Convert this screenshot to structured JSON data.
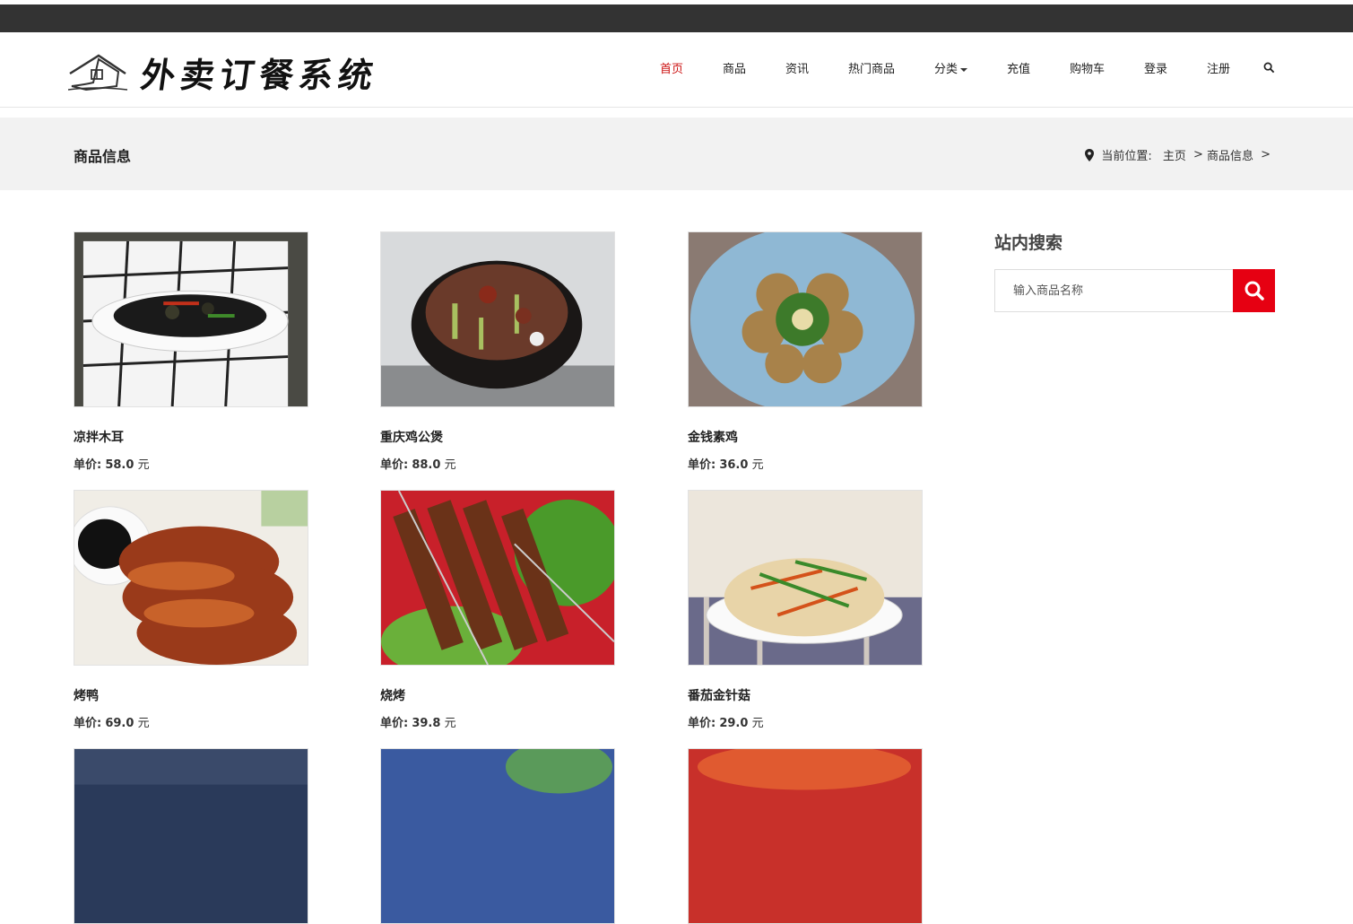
{
  "site": {
    "logo_text": "外卖订餐系统"
  },
  "nav": {
    "items": [
      {
        "label": "首页",
        "active": true
      },
      {
        "label": "商品"
      },
      {
        "label": "资讯"
      },
      {
        "label": "热门商品"
      },
      {
        "label": "分类",
        "dropdown": true
      },
      {
        "label": "充值"
      },
      {
        "label": "购物车"
      },
      {
        "label": "登录"
      },
      {
        "label": "注册"
      }
    ]
  },
  "titlebar": {
    "title": "商品信息",
    "breadcrumb_prefix": "当前位置:",
    "crumbs": [
      "主页",
      ">",
      "商品信息",
      ">"
    ]
  },
  "products": [
    {
      "name": "凉拌木耳",
      "price_label": "单价:",
      "price": "58.0",
      "unit": "元"
    },
    {
      "name": "重庆鸡公煲",
      "price_label": "单价:",
      "price": "88.0",
      "unit": "元"
    },
    {
      "name": "金钱素鸡",
      "price_label": "单价:",
      "price": "36.0",
      "unit": "元"
    },
    {
      "name": "烤鸭",
      "price_label": "单价:",
      "price": "69.0",
      "unit": "元"
    },
    {
      "name": "烧烤",
      "price_label": "单价:",
      "price": "39.8",
      "unit": "元"
    },
    {
      "name": "番茄金针菇",
      "price_label": "单价:",
      "price": "29.0",
      "unit": "元"
    }
  ],
  "sidebar": {
    "title": "站内搜索",
    "search_placeholder": "输入商品名称"
  },
  "colors": {
    "accent": "#e60012",
    "nav_active": "#cc1010",
    "dark_bar": "#333333"
  }
}
